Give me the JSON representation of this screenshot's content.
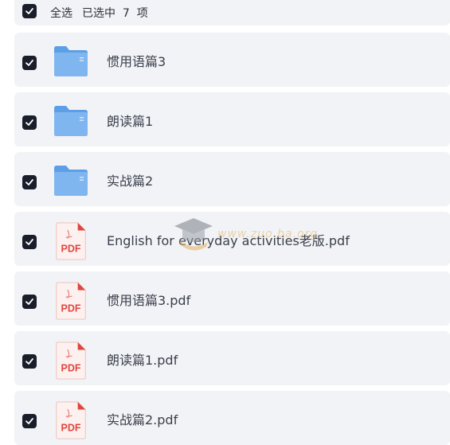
{
  "header": {
    "select_all_label": "全选",
    "selected_count_text": "已选中  7  项"
  },
  "files": [
    {
      "name": "惯用语篇3",
      "type": "folder",
      "checked": true
    },
    {
      "name": "朗读篇1",
      "type": "folder",
      "checked": true
    },
    {
      "name": "实战篇2",
      "type": "folder",
      "checked": true
    },
    {
      "name": "English for everyday activities老版.pdf",
      "type": "pdf",
      "checked": true
    },
    {
      "name": "惯用语篇3.pdf",
      "type": "pdf",
      "checked": true
    },
    {
      "name": "朗读篇1.pdf",
      "type": "pdf",
      "checked": true
    },
    {
      "name": "实战篇2.pdf",
      "type": "pdf",
      "checked": true
    }
  ],
  "icons": {
    "folder": "folder-icon",
    "pdf": "pdf-file-icon",
    "pdf_label": "PDF"
  },
  "colors": {
    "checkbox": "#1a1d2a",
    "row_bg": "#f2f3f6",
    "folder": "#7fb6ef",
    "pdf_red": "#e0463f"
  },
  "watermark": {
    "text": "www.zuo.ba.org"
  }
}
